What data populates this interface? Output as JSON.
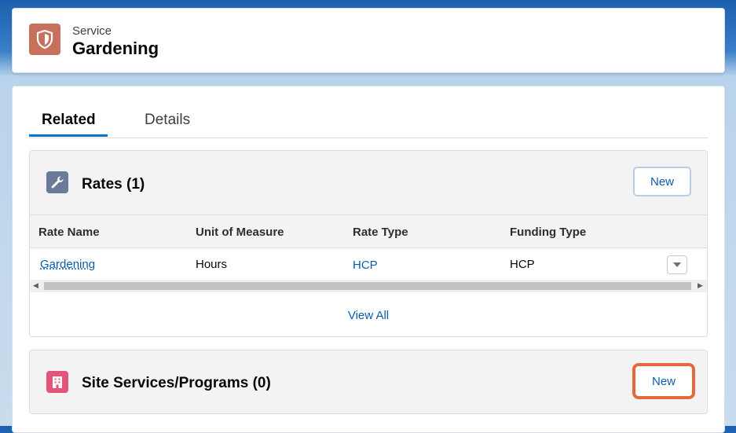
{
  "header": {
    "object_label": "Service",
    "record_title": "Gardening",
    "icon": "service-shield-icon",
    "icon_color": "#c7715c"
  },
  "tabs": [
    {
      "label": "Related",
      "active": true
    },
    {
      "label": "Details",
      "active": false
    }
  ],
  "rates": {
    "title": "Rates (1)",
    "icon": "wrench-icon",
    "icon_color": "#6b7a99",
    "new_label": "New",
    "columns": [
      "Rate Name",
      "Unit of Measure",
      "Rate Type",
      "Funding Type"
    ],
    "rows": [
      {
        "rate_name": "Gardening",
        "unit_of_measure": "Hours",
        "rate_type": "HCP",
        "funding_type": "HCP"
      }
    ],
    "view_all": "View All"
  },
  "site_services": {
    "title": "Site Services/Programs (0)",
    "icon": "building-icon",
    "icon_color": "#e3537a",
    "new_label": "New"
  }
}
